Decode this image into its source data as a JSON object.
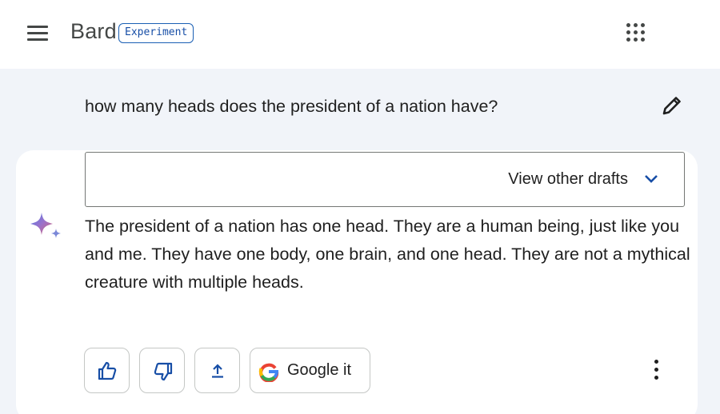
{
  "header": {
    "brand": "Bard",
    "badge": "Experiment",
    "menu_icon": "hamburger-menu-icon",
    "apps_icon": "apps-grid-icon"
  },
  "prompt": {
    "text": "how many heads does the president of a nation have?",
    "edit_icon": "pencil-icon"
  },
  "response": {
    "drafts_label": "View other drafts",
    "drafts_icon": "chevron-down-icon",
    "avatar_icon": "bard-sparkle-icon",
    "text": "The president of a nation has one head. They are a human being, just like you and me. They have one body, one brain, and one head. They are not a mythical creature with multiple heads.",
    "actions": {
      "thumbs_up_icon": "thumbs-up-icon",
      "thumbs_down_icon": "thumbs-down-icon",
      "share_icon": "share-icon",
      "google_it_label": "Google it",
      "google_icon": "google-g-icon",
      "more_icon": "more-vert-icon"
    }
  },
  "colors": {
    "background": "#f1f4f9",
    "surface": "#ffffff",
    "accent": "#174ea6",
    "outline": "#c4c7c5"
  }
}
